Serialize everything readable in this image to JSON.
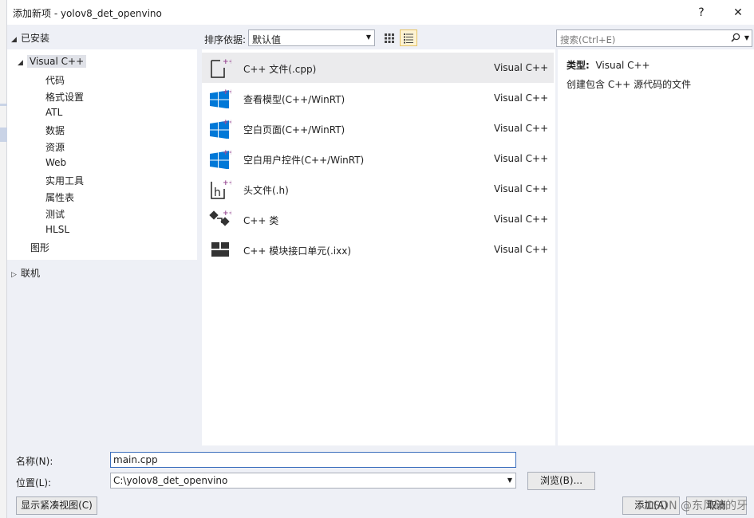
{
  "dialog": {
    "title": "添加新项 - yolov8_det_openvino",
    "help_label": "?",
    "close_label": "✕"
  },
  "left_panel": {
    "installed_label": "已安装",
    "root_item": "Visual C++",
    "children": [
      "代码",
      "格式设置",
      "ATL",
      "数据",
      "资源",
      "Web",
      "实用工具",
      "属性表",
      "测试",
      "HLSL"
    ],
    "graphics_item": "图形",
    "online_label": "联机"
  },
  "toolbar": {
    "sort_label": "排序依据:",
    "sort_value": "默认值"
  },
  "search": {
    "placeholder": "搜索(Ctrl+E)"
  },
  "templates": [
    {
      "name": "C++ 文件(.cpp)",
      "lang": "Visual C++",
      "icon": "cpp-file-icon"
    },
    {
      "name": "查看模型(C++/WinRT)",
      "lang": "Visual C++",
      "icon": "windows-icon"
    },
    {
      "name": "空白页面(C++/WinRT)",
      "lang": "Visual C++",
      "icon": "windows-icon"
    },
    {
      "name": "空白用户控件(C++/WinRT)",
      "lang": "Visual C++",
      "icon": "windows-icon"
    },
    {
      "name": "头文件(.h)",
      "lang": "Visual C++",
      "icon": "header-file-icon"
    },
    {
      "name": "C++ 类",
      "lang": "Visual C++",
      "icon": "class-icon"
    },
    {
      "name": "C++ 模块接口单元(.ixx)",
      "lang": "Visual C++",
      "icon": "module-icon"
    }
  ],
  "details": {
    "type_label": "类型:",
    "type_value": "Visual C++",
    "description": "创建包含 C++ 源代码的文件"
  },
  "bottom": {
    "name_label": "名称(N):",
    "name_value": "main.cpp",
    "location_label": "位置(L):",
    "location_value": "C:\\yolov8_det_openvino",
    "browse_label": "浏览(B)...",
    "compact_label": "显示紧凑视图(C)",
    "add_label": "添加(A)",
    "cancel_label": "取消"
  },
  "watermark": "CSDN @东风破的牙",
  "colors": {
    "windows_blue": "#0078d7",
    "plus_purple": "#9b4f96",
    "selection": "#ebebed",
    "focus_border": "#3c6fbd"
  }
}
